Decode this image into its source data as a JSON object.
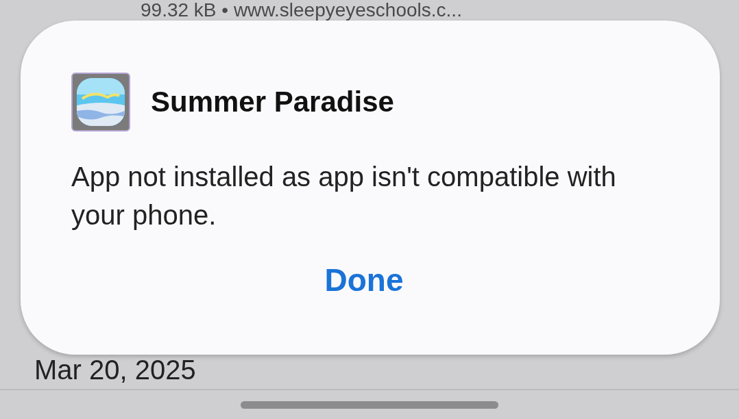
{
  "background": {
    "file_info": "99.32 kB • www.sleepyeyeschools.c...",
    "date": "Mar 20, 2025"
  },
  "dialog": {
    "app_name": "Summer Paradise",
    "message": "App not installed as app isn't compatible with your phone.",
    "button": "Done"
  }
}
